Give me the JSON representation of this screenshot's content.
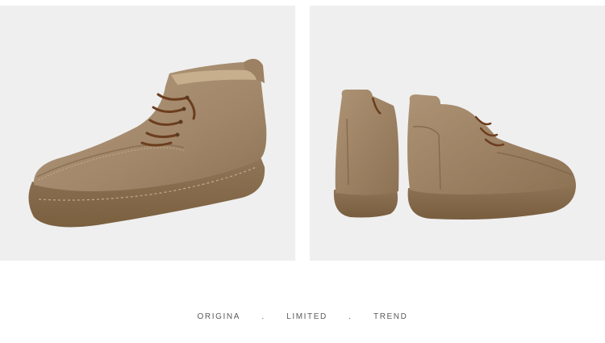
{
  "images": [
    {
      "name": "single-boot-side-view",
      "colors": {
        "suede": "#a48a6b",
        "sole": "#8a6f4e",
        "lace": "#6b3d1e"
      }
    },
    {
      "name": "boot-pair-rear-view",
      "colors": {
        "suede": "#a48a6b",
        "sole": "#8a6f4e",
        "lace": "#6b3d1e"
      }
    }
  ],
  "tagline": {
    "word1": "ORIGINA",
    "sep1": ".",
    "word2": "LIMITED",
    "sep2": ".",
    "word3": "TREND"
  }
}
